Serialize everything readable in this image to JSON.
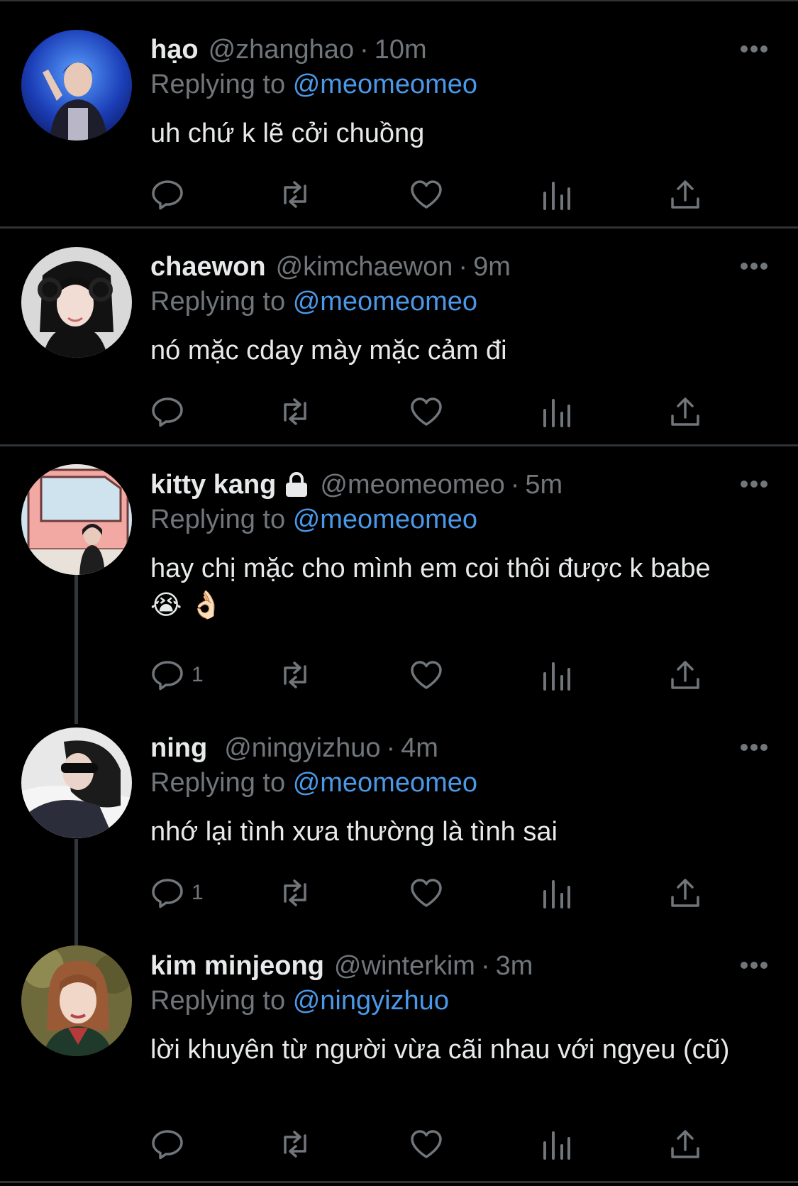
{
  "reply_prefix": "Replying to",
  "colors": {
    "background": "#000000",
    "text": "#e7e9ea",
    "muted": "#71767b",
    "mention": "#4a99e9",
    "divider": "#2f3336"
  },
  "tweets": [
    {
      "name": "hạo",
      "handle": "@zhanghao",
      "time": "10m",
      "replying_to": "@meomeomeo",
      "text": "uh chứ k lẽ cởi chuồng",
      "reply_count": "",
      "locked": false
    },
    {
      "name": "chaewon",
      "handle": "@kimchaewon",
      "time": "9m",
      "replying_to": "@meomeomeo",
      "text": "nó mặc cday mày mặc cảm đi",
      "reply_count": "",
      "locked": false
    },
    {
      "name": "kitty kang",
      "handle": "@meomeomeo",
      "time": "5m",
      "replying_to": "@meomeomeo",
      "text": "hay chị mặc cho mình em coi thôi được k babe",
      "emoji": "😭 👌🏻",
      "reply_count": "1",
      "locked": true
    },
    {
      "name": "ning",
      "handle": "@ningyizhuo",
      "time": "4m",
      "replying_to": "@meomeomeo",
      "text": "nhớ lại tình xưa thường là tình sai",
      "reply_count": "1",
      "locked": false
    },
    {
      "name": "kim minjeong",
      "handle": "@winterkim",
      "time": "3m",
      "replying_to": "@ningyizhuo",
      "text": "lời khuyên từ người vừa cãi nhau với ngyeu (cũ)",
      "reply_count": "",
      "locked": false
    }
  ]
}
